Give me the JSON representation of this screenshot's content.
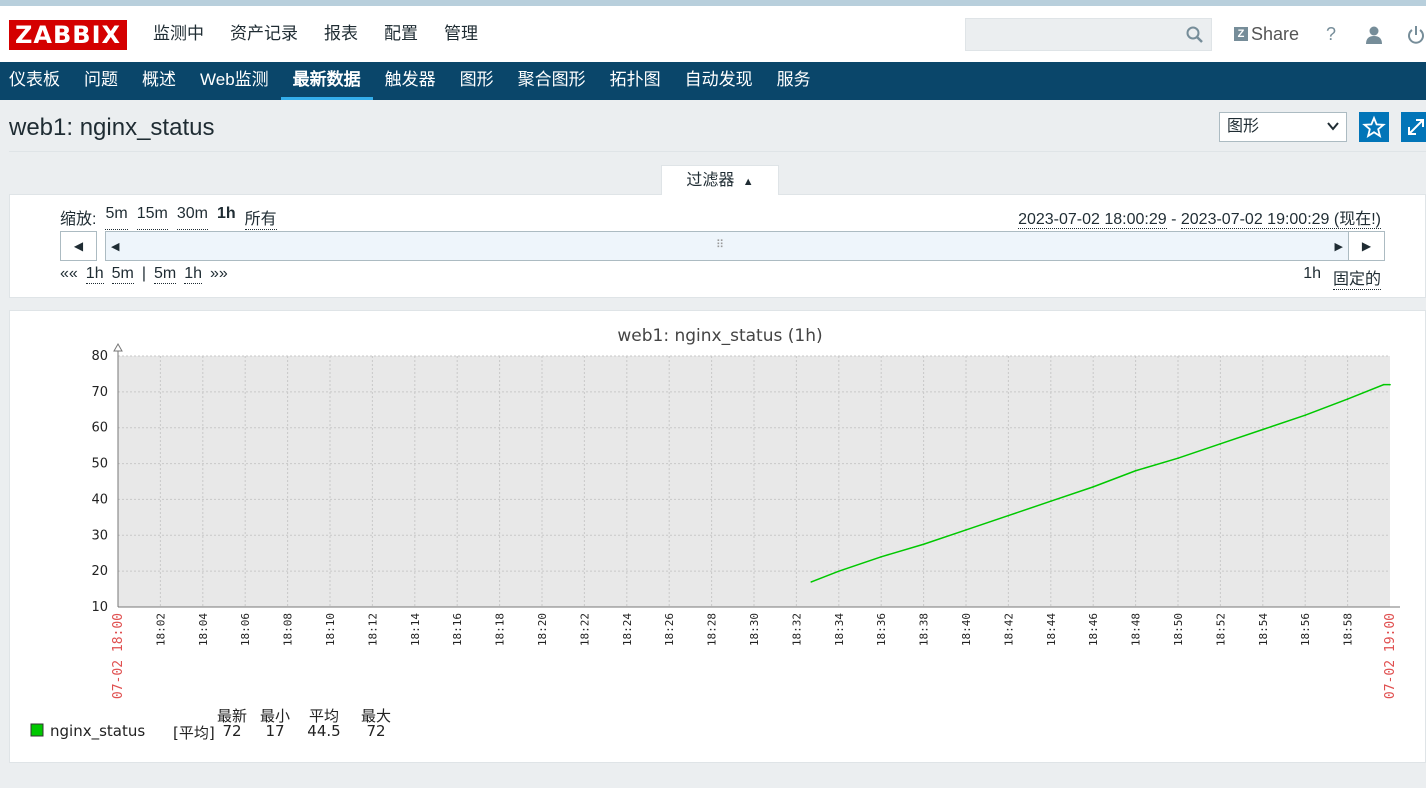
{
  "logo": "ZABBIX",
  "main_nav": [
    "监测中",
    "资产记录",
    "报表",
    "配置",
    "管理"
  ],
  "header_actions": {
    "share_label": "Share",
    "help_label": "?"
  },
  "search": {
    "value": "",
    "placeholder": ""
  },
  "sub_nav": [
    {
      "label": "仪表板",
      "active": false
    },
    {
      "label": "问题",
      "active": false
    },
    {
      "label": "概述",
      "active": false
    },
    {
      "label": "Web监测",
      "active": false
    },
    {
      "label": "最新数据",
      "active": true
    },
    {
      "label": "触发器",
      "active": false
    },
    {
      "label": "图形",
      "active": false
    },
    {
      "label": "聚合图形",
      "active": false
    },
    {
      "label": "拓扑图",
      "active": false
    },
    {
      "label": "自动发现",
      "active": false
    },
    {
      "label": "服务",
      "active": false
    }
  ],
  "page": {
    "title": "web1: nginx_status",
    "view_select": "图形"
  },
  "filter": {
    "tab_label": "过滤器",
    "zoom_label": "缩放:",
    "zoom_options": [
      "5m",
      "15m",
      "30m",
      "1h",
      "所有"
    ],
    "zoom_selected": "1h",
    "range_from": "2023-07-02 18:00:29",
    "range_sep": " - ",
    "range_to": "2023-07-02 19:00:29 (现在!)",
    "shift_back": "««",
    "shift_back_links": [
      "1h",
      "5m"
    ],
    "shift_sep": "|",
    "shift_fwd_links": [
      "5m",
      "1h"
    ],
    "shift_fwd": "»»",
    "period_label": "1h",
    "fixed_label": "固定的"
  },
  "chart_data": {
    "type": "line",
    "title": "web1: nginx_status (1h)",
    "ylim": [
      10,
      80
    ],
    "yticks": [
      10,
      20,
      30,
      40,
      50,
      60,
      70,
      80
    ],
    "x_ticks": [
      "18:02",
      "18:04",
      "18:06",
      "18:08",
      "18:10",
      "18:12",
      "18:14",
      "18:16",
      "18:18",
      "18:20",
      "18:22",
      "18:24",
      "18:26",
      "18:28",
      "18:30",
      "18:32",
      "18:34",
      "18:36",
      "18:38",
      "18:40",
      "18:42",
      "18:44",
      "18:46",
      "18:48",
      "18:50",
      "18:52",
      "18:54",
      "18:56",
      "18:58"
    ],
    "x_start_label": "07-02 18:00",
    "x_end_label": "07-02 19:00",
    "grid": true,
    "series": [
      {
        "name": "nginx_status",
        "color": "#00c800",
        "x_minutes": [
          32.7,
          34,
          36,
          38,
          40,
          42,
          44,
          46,
          48,
          50,
          52,
          54,
          56,
          58,
          59.7,
          60
        ],
        "values": [
          17,
          20,
          24,
          27.5,
          31.5,
          35.5,
          39.5,
          43.5,
          48,
          51.5,
          55.5,
          59.5,
          63.5,
          68,
          72,
          72
        ]
      }
    ],
    "legend": {
      "unit_label": "[平均]",
      "stat_headers": [
        "最新",
        "最小",
        "平均",
        "最大"
      ],
      "stats": [
        "72",
        "17",
        "44.5",
        "72"
      ]
    }
  }
}
